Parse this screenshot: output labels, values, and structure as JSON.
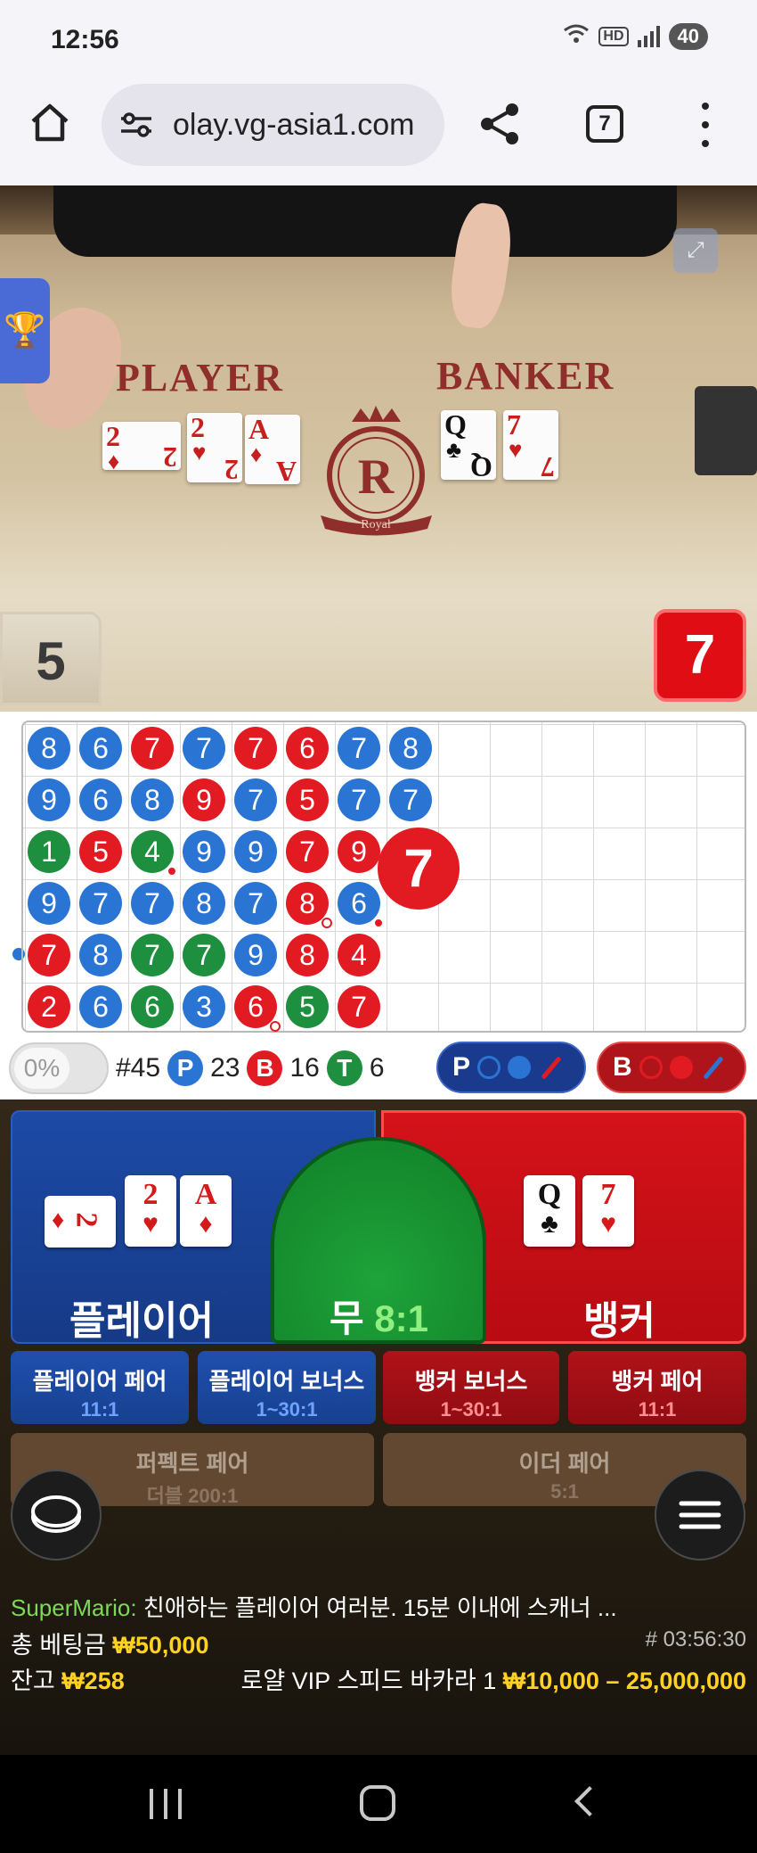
{
  "status_bar": {
    "time": "12:56",
    "battery": "40",
    "hd": "HD"
  },
  "browser": {
    "url": "olay.vg-asia1.com",
    "tab_count": "7"
  },
  "video": {
    "player_title": "PLAYER",
    "banker_title": "BANKER",
    "logo_text": "Royal",
    "logo_letter": "R",
    "player_cards": [
      {
        "rank": "2",
        "suit": "♦",
        "color": "red"
      },
      {
        "rank": "2",
        "suit": "♥",
        "color": "red"
      },
      {
        "rank": "A",
        "suit": "♦",
        "color": "red"
      }
    ],
    "banker_cards": [
      {
        "rank": "Q",
        "suit": "♣",
        "color": "black"
      },
      {
        "rank": "7",
        "suit": "♥",
        "color": "red"
      }
    ],
    "player_score": "5",
    "banker_score": "7"
  },
  "road": {
    "columns": [
      [
        {
          "v": "8",
          "c": "P"
        },
        {
          "v": "9",
          "c": "P"
        },
        {
          "v": "1",
          "c": "T"
        },
        {
          "v": "9",
          "c": "P"
        },
        {
          "v": "7",
          "c": "B"
        },
        {
          "v": "2",
          "c": "B"
        }
      ],
      [
        {
          "v": "6",
          "c": "P"
        },
        {
          "v": "6",
          "c": "P"
        },
        {
          "v": "5",
          "c": "B"
        },
        {
          "v": "7",
          "c": "P"
        },
        {
          "v": "8",
          "c": "P"
        },
        {
          "v": "6",
          "c": "P"
        }
      ],
      [
        {
          "v": "7",
          "c": "B"
        },
        {
          "v": "8",
          "c": "P"
        },
        {
          "v": "4",
          "c": "T",
          "dot": "red"
        },
        {
          "v": "7",
          "c": "P"
        },
        {
          "v": "7",
          "c": "T"
        },
        {
          "v": "6",
          "c": "T"
        }
      ],
      [
        {
          "v": "7",
          "c": "P"
        },
        {
          "v": "9",
          "c": "B"
        },
        {
          "v": "9",
          "c": "P"
        },
        {
          "v": "8",
          "c": "P"
        },
        {
          "v": "7",
          "c": "T"
        },
        {
          "v": "3",
          "c": "P"
        }
      ],
      [
        {
          "v": "7",
          "c": "B"
        },
        {
          "v": "7",
          "c": "P"
        },
        {
          "v": "9",
          "c": "P"
        },
        {
          "v": "7",
          "c": "P"
        },
        {
          "v": "9",
          "c": "P"
        },
        {
          "v": "6",
          "c": "B",
          "dot": "white"
        }
      ],
      [
        {
          "v": "6",
          "c": "B"
        },
        {
          "v": "5",
          "c": "B"
        },
        {
          "v": "7",
          "c": "B"
        },
        {
          "v": "8",
          "c": "B",
          "dot": "white"
        },
        {
          "v": "8",
          "c": "B"
        },
        {
          "v": "5",
          "c": "T"
        }
      ],
      [
        {
          "v": "7",
          "c": "P"
        },
        {
          "v": "7",
          "c": "P"
        },
        {
          "v": "9",
          "c": "B"
        },
        {
          "v": "6",
          "c": "P",
          "dot": "red"
        },
        {
          "v": "4",
          "c": "B"
        },
        {
          "v": "7",
          "c": "B"
        }
      ],
      [
        {
          "v": "8",
          "c": "P"
        },
        {
          "v": "7",
          "c": "P"
        }
      ]
    ],
    "latest": "7",
    "percent": "0%",
    "round_no": "#45",
    "p_label": "P",
    "p_count": "23",
    "b_label": "B",
    "b_count": "16",
    "t_label": "T",
    "t_count": "6",
    "pred_p": "P",
    "pred_b": "B"
  },
  "bets": {
    "player_label": "플레이어",
    "banker_label": "뱅커",
    "tie_label": "무",
    "tie_odds": "8:1",
    "player_cards": [
      {
        "rank": "2",
        "suit": "♦"
      },
      {
        "rank": "2",
        "suit": "♥"
      },
      {
        "rank": "A",
        "suit": "♦"
      }
    ],
    "banker_cards": [
      {
        "rank": "Q",
        "suit": "♣"
      },
      {
        "rank": "7",
        "suit": "♥"
      }
    ],
    "side_bets": [
      {
        "label": "플레이어 페어",
        "odds": "11:1"
      },
      {
        "label": "플레이어 보너스",
        "odds": "1~30:1"
      },
      {
        "label": "뱅커 보너스",
        "odds": "1~30:1"
      },
      {
        "label": "뱅커 페어",
        "odds": "11:1"
      },
      {
        "label": "퍼펙트 페어",
        "odds": "더블 200:1"
      },
      {
        "label": "이더 페어",
        "odds": "5:1"
      }
    ]
  },
  "info": {
    "chat_user": "SuperMario:",
    "chat_message": " 친애하는 플레이어 여러분. 15분 이내에 스캐너 ...",
    "total_bet_label": "총 베팅금",
    "total_bet": "₩50,000",
    "round_id": "# 03:56:30",
    "balance_label": "잔고",
    "balance": "₩258",
    "table_name": "로얄 VIP 스피드 바카라 1",
    "table_limit": "₩10,000 – 25,000,000"
  },
  "colors": {
    "player": "#2a75d4",
    "banker": "#e21b23",
    "tie": "#1e8f3f",
    "accent_yellow": "#ffd21f"
  }
}
